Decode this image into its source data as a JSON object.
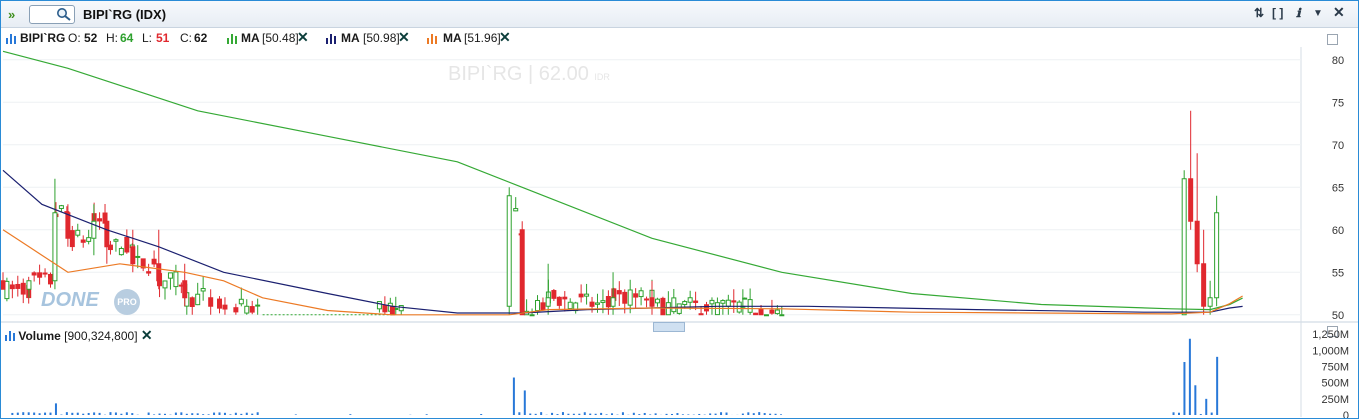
{
  "title_bar": {
    "symbol": "BIPI`RG (IDX)",
    "expand_icon": "double-chevron-right-icon",
    "search_icon": "search-icon",
    "buttons": [
      {
        "name": "sort-icon",
        "glyph": "⇅"
      },
      {
        "name": "fullscreen-icon",
        "glyph": "[ ]"
      },
      {
        "name": "info-icon",
        "glyph": "ℹ"
      },
      {
        "name": "menu-down-icon",
        "glyph": "▼"
      },
      {
        "name": "close-icon",
        "glyph": "✕"
      }
    ]
  },
  "legend": {
    "symbol": "BIPI`RG",
    "o_label": "O:",
    "o_value": "52",
    "h_label": "H:",
    "h_value": "64",
    "l_label": "L:",
    "l_value": "51",
    "c_label": "C:",
    "c_value": "62",
    "ma1_label": "MA",
    "ma1_value": "[50.48]",
    "ma2_label": "MA",
    "ma2_value": "[50.98]",
    "ma3_label": "MA",
    "ma3_value": "[51.96]",
    "remove_glyph": "✕"
  },
  "watermark": {
    "text": "BIPI`RG | 62.00",
    "currency": "IDR"
  },
  "logo": {
    "text": "DONE",
    "badge": "PRO"
  },
  "volume_legend": {
    "label": "Volume",
    "value": "[900,324,800]",
    "remove_glyph": "✕"
  },
  "colors": {
    "up": "#2ea12e",
    "down": "#e0282e",
    "ma_green": "#35a935",
    "ma_navy": "#1b2070",
    "ma_orange": "#ec7a25",
    "volume": "#2878d8",
    "border": "#2a8bd6"
  },
  "chart_data": [
    {
      "type": "candlestick",
      "title": "BIPI`RG | 62.00",
      "y_ticks": [
        50,
        55,
        60,
        65,
        70,
        75,
        80
      ],
      "ylim": [
        49.5,
        81.5
      ],
      "last": {
        "open": 52,
        "high": 64,
        "low": 51,
        "close": 62
      },
      "series": [
        {
          "name": "MA",
          "value": 50.48
        },
        {
          "name": "MA",
          "value": 50.98
        },
        {
          "name": "MA",
          "value": 51.96
        }
      ],
      "price_path": [
        {
          "x": 0,
          "o": 54,
          "h": 55,
          "l": 53,
          "c": 53
        },
        {
          "x": 0.02,
          "o": 53,
          "h": 54,
          "l": 52,
          "c": 54
        },
        {
          "x": 0.04,
          "o": 54,
          "h": 66,
          "l": 53,
          "c": 62
        },
        {
          "x": 0.05,
          "o": 62,
          "h": 63,
          "l": 58,
          "c": 59
        },
        {
          "x": 0.07,
          "o": 59,
          "h": 63,
          "l": 57,
          "c": 61
        },
        {
          "x": 0.08,
          "o": 61,
          "h": 62,
          "l": 56,
          "c": 58
        },
        {
          "x": 0.1,
          "o": 58,
          "h": 60,
          "l": 55,
          "c": 56
        },
        {
          "x": 0.12,
          "o": 56,
          "h": 60,
          "l": 53,
          "c": 54
        },
        {
          "x": 0.14,
          "o": 54,
          "h": 56,
          "l": 51,
          "c": 52
        },
        {
          "x": 0.16,
          "o": 52,
          "h": 53,
          "l": 50,
          "c": 51
        },
        {
          "x": 0.3,
          "o": 51,
          "h": 51,
          "l": 50,
          "c": 50
        },
        {
          "x": 0.39,
          "o": 51,
          "h": 65,
          "l": 50,
          "c": 64
        },
        {
          "x": 0.4,
          "o": 60,
          "h": 61,
          "l": 50,
          "c": 50
        },
        {
          "x": 0.42,
          "o": 51,
          "h": 56,
          "l": 50,
          "c": 52
        },
        {
          "x": 0.47,
          "o": 51,
          "h": 55,
          "l": 50,
          "c": 52
        },
        {
          "x": 0.5,
          "o": 52,
          "h": 54,
          "l": 50,
          "c": 51
        },
        {
          "x": 0.57,
          "o": 51,
          "h": 53,
          "l": 50,
          "c": 51
        },
        {
          "x": 0.6,
          "o": 50,
          "h": 51,
          "l": 50,
          "c": 50
        },
        {
          "x": 0.91,
          "o": 50,
          "h": 67,
          "l": 50,
          "c": 66
        },
        {
          "x": 0.915,
          "o": 66,
          "h": 74,
          "l": 60,
          "c": 61
        },
        {
          "x": 0.92,
          "o": 61,
          "h": 69,
          "l": 55,
          "c": 56
        },
        {
          "x": 0.925,
          "o": 56,
          "h": 60,
          "l": 50,
          "c": 51
        },
        {
          "x": 0.93,
          "o": 51,
          "h": 54,
          "l": 50,
          "c": 52
        },
        {
          "x": 0.935,
          "o": 52,
          "h": 64,
          "l": 51,
          "c": 62
        }
      ]
    },
    {
      "type": "bar",
      "series": [
        {
          "name": "Volume",
          "last": 900324800
        }
      ],
      "y_ticks": [
        "0",
        "250M",
        "500M",
        "750M",
        "1,000M",
        "1,250M"
      ],
      "ylim": [
        0,
        1300000000
      ]
    }
  ]
}
